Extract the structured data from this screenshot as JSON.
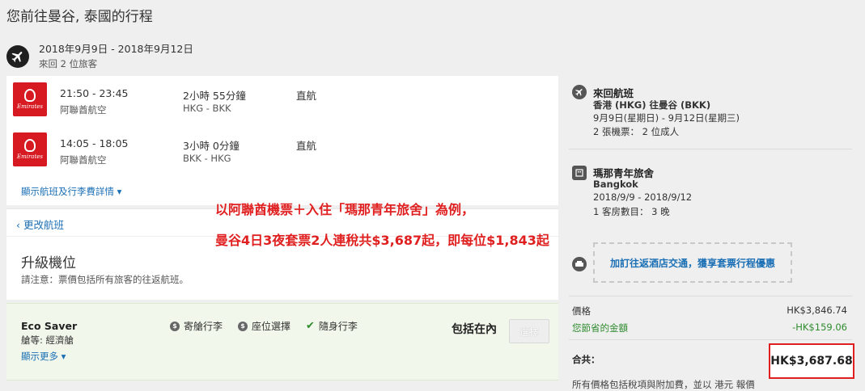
{
  "page": {
    "title": "您前往曼谷, 泰國的行程",
    "dates": "2018年9月9日 - 2018年9月12日",
    "sub": "來回   2 位旅客"
  },
  "flights": [
    {
      "time": "21:50 - 23:45",
      "airline": "阿聯酋航空",
      "duration": "2小時 55分鐘",
      "route": "HKG - BKK",
      "stops": "直航",
      "logo_text": "Emirates"
    },
    {
      "time": "14:05 - 18:05",
      "airline": "阿聯酋航空",
      "duration": "3小時 0分鐘",
      "route": "BKK - HKG",
      "stops": "直航",
      "logo_text": "Emirates"
    }
  ],
  "links": {
    "details": "顯示航班及行李費詳情 ▾",
    "change_flight": "‹ 更改航班",
    "show_more": "顯示更多 ▾"
  },
  "upgrade": {
    "title": "升級機位",
    "note": "請注意：票價包括所有旅客的往返航班。"
  },
  "fare": {
    "name": "Eco Saver",
    "class": "艙等: 經濟艙",
    "features": [
      {
        "label": "寄艙行李",
        "icon": "dollar-icon"
      },
      {
        "label": "座位選擇",
        "icon": "dollar-icon"
      },
      {
        "label": "隨身行李",
        "icon": "check-icon"
      }
    ],
    "included": "包括在內",
    "select_button": "選擇"
  },
  "promo": {
    "line1": "以阿聯酋機票＋入住「瑪那青年旅舍」為例，",
    "line2": "曼谷4日3夜套票2人連稅共$3,687起，即每位$1,843起"
  },
  "summary": {
    "flight_head": "來回航班",
    "flight_route": "香港 (HKG) 往曼谷 (BKK)",
    "flight_dates": "9月9日(星期日) - 9月12日(星期三)",
    "flight_tickets": "2 張機票： 2 位成人",
    "hotel_head": "瑪那青年旅舍",
    "hotel_city": "Bangkok",
    "hotel_dates": "2018/9/9 - 2018/9/12",
    "hotel_rooms": "1 客房數目： 3 晚",
    "transfer_link": "加訂往返酒店交通，獲享套票行程優惠",
    "price_label": "價格",
    "price_value": "HK$3,846.74",
    "saved_label": "您節省的金額",
    "saved_value": "-HK$159.06",
    "total_label": "合共：",
    "total_value": "HK$3,687.68",
    "footnote": "所有價格包括稅項與附加費，並以 港元 報價"
  },
  "colors": {
    "link": "#1a6fb5",
    "promo": "#e02020",
    "saved": "#2e8b2e",
    "brand": "#d71921"
  }
}
